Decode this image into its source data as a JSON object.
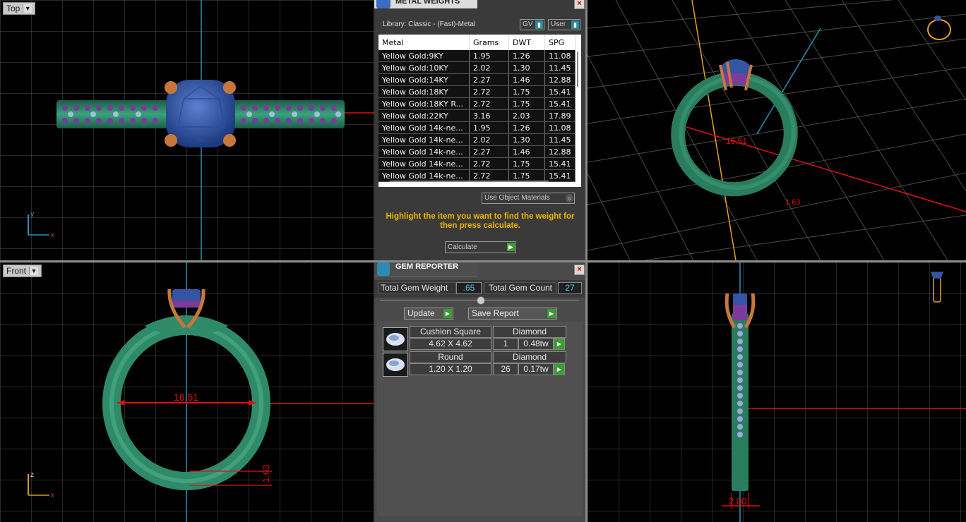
{
  "viewports": {
    "top": {
      "label": "Top",
      "axis_y": "y",
      "axis_x": "x"
    },
    "front": {
      "label": "Front",
      "axis_z": "z",
      "axis_x": "x",
      "dim_inner": "16.51",
      "dim_thickness": "1.63"
    },
    "perspective": {
      "dim_inner": "16.51",
      "dim_small": "1.63"
    },
    "right": {
      "dim_width": "2.00"
    }
  },
  "metal_weights": {
    "title": "METAL WEIGHTS",
    "library": "Library: Classic - (Fast)-Metal",
    "gv_label": "GV",
    "user_label": "User",
    "columns": [
      "Metal",
      "Grams",
      "DWT",
      "SPG"
    ],
    "rows": [
      [
        "Yellow Gold:9KY",
        "1.95",
        "1.26",
        "11.08"
      ],
      [
        "Yellow Gold:10KY",
        "2.02",
        "1.30",
        "11.45"
      ],
      [
        "Yellow Gold:14KY",
        "2.27",
        "1.46",
        "12.88"
      ],
      [
        "Yellow Gold:18KY",
        "2.72",
        "1.75",
        "15.41"
      ],
      [
        "Yellow Gold:18KY R...",
        "2.72",
        "1.75",
        "15.41"
      ],
      [
        "Yellow Gold:22KY",
        "3.16",
        "2.03",
        "17.89"
      ],
      [
        "Yellow Gold 14k-ne...",
        "1.95",
        "1.26",
        "11.08"
      ],
      [
        "Yellow Gold 14k-ne...",
        "2.02",
        "1.30",
        "11.45"
      ],
      [
        "Yellow Gold 14k-ne...",
        "2.27",
        "1.46",
        "12.88"
      ],
      [
        "Yellow Gold 14k-ne...",
        "2.72",
        "1.75",
        "15.41"
      ],
      [
        "Yellow Gold 14k-ne...",
        "2.72",
        "1.75",
        "15.41"
      ]
    ],
    "use_object_materials": "Use Object Materials",
    "instruction": "Highlight the item you want to find the weight for then press calculate.",
    "calculate": "Calculate"
  },
  "gem_reporter": {
    "title": "GEM REPORTER",
    "total_weight_label": "Total Gem Weight",
    "total_weight_value": ".65",
    "total_count_label": "Total Gem Count",
    "total_count_value": "27",
    "update": "Update",
    "save_report": "Save Report",
    "gems": [
      {
        "shape": "Cushion Square",
        "material": "Diamond",
        "size": "4.62 X 4.62",
        "count": "1",
        "weight": "0.48tw"
      },
      {
        "shape": "Round",
        "material": "Diamond",
        "size": "1.20 X 1.20",
        "count": "26",
        "weight": "0.17tw"
      }
    ]
  },
  "colors": {
    "band": "#2f8a6a",
    "prong": "#c8773a",
    "stone": "#3455a4",
    "accent_gem": "#7a3b9a",
    "grid": "#555555",
    "dimension": "#e01010",
    "axis_blue": "#2a8fb8",
    "instruction_text": "#f0b400",
    "go_button": "#3c9b32"
  }
}
